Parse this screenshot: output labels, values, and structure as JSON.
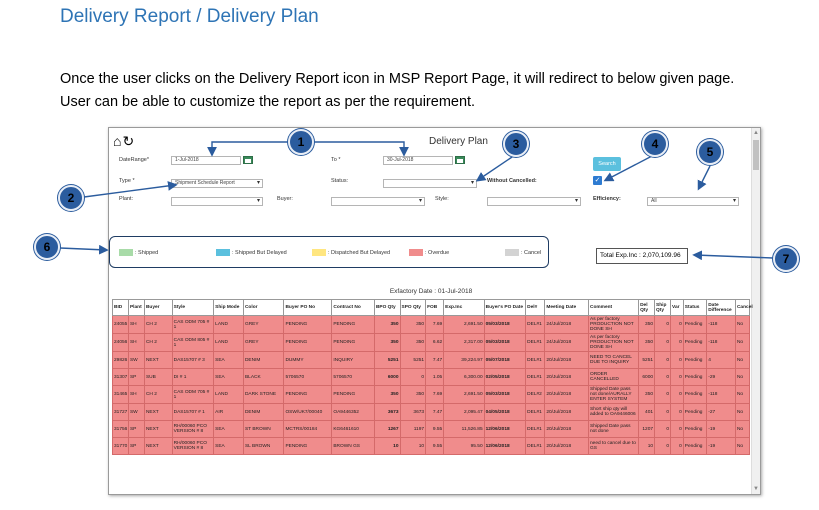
{
  "heading": "Delivery Report / Delivery Plan",
  "paragraph": {
    "line1": "Once the user clicks on the Delivery Report icon in MSP Report Page, it will redirect to below given page.",
    "line2": "User can be able to customize the report as per the requirement."
  },
  "app": {
    "title": "Delivery Plan",
    "filters": {
      "date_range_label": "DateRange*",
      "date_from": "1-Jul-2018",
      "to_label": "To *",
      "date_to": "30-Jul-2018",
      "type_label": "Type *",
      "type_value": "Shipment Schedule Report",
      "status_label": "Status:",
      "status_value": "",
      "without_cancelled_label": "Without Cancelled:",
      "plant_label": "Plant:",
      "buyer_label": "Buyer:",
      "style_label": "Style:",
      "efficiency_label": "Efficiency:",
      "efficiency_value": "All",
      "search_label": "Search"
    },
    "legend": [
      {
        "label": ": Shipped",
        "color": "#a8dba8"
      },
      {
        "label": ": Shipped But Delayed",
        "color": "#5bc0de"
      },
      {
        "label": ": Dispatched But Delayed",
        "color": "#ffe680"
      },
      {
        "label": ": Overdue",
        "color": "#f08c8c"
      },
      {
        "label": ": Cancel",
        "color": "#d3d3d3"
      }
    ],
    "total": "Total Exp.Inc : 2,070,109.96",
    "exfactory_date": "Exfactory Date : 01-Jul-2018",
    "columns": [
      "BID",
      "Plant",
      "Buyer",
      "Style",
      "Ship Mode",
      "Color",
      "Buyer PO No",
      "Contract No",
      "BPO Qty",
      "SPO Qty",
      "FOB",
      "Exp.Inc",
      "Buyer's PO Date",
      "Del#",
      "Meeting Date",
      "Comment",
      "Del Qty",
      "Ship Qty",
      "Var",
      "Status",
      "Date Difference",
      "Cancel"
    ],
    "rows": [
      [
        "24055",
        "SH",
        "CH 2",
        "CAS ODM 705 # 1",
        "LAND",
        "GREY",
        "PENDING",
        "PENDING",
        "350",
        "350",
        "7.69",
        "2,691.50",
        "05/03/2018",
        "DEL#1",
        "24/Jul/2018",
        "As per factory PRODUCTION NOT DONE SH",
        "350",
        "0",
        "0",
        "Pending",
        "-118",
        "No"
      ],
      [
        "24056",
        "SH",
        "CH 2",
        "CAS ODM 805 # 1",
        "LAND",
        "GREY",
        "PENDING",
        "PENDING",
        "350",
        "350",
        "6.62",
        "2,317.00",
        "05/03/2018",
        "DEL#1",
        "24/Jul/2018",
        "As per factory PRODUCTION NOT DONE SH",
        "350",
        "0",
        "0",
        "Pending",
        "-118",
        "No"
      ],
      [
        "29826",
        "SW",
        "NEXT",
        "DAS15707 # 3",
        "SEA",
        "DENIM",
        "DUMMY",
        "INQUIRY",
        "5251",
        "5251",
        "7.47",
        "39,224.97",
        "05/07/2018",
        "DEL#1",
        "20/Jul/2018",
        "NEED TO CANCEL DUE TO INQUIRY",
        "5251",
        "0",
        "0",
        "Pending",
        "4",
        "No"
      ],
      [
        "31307",
        "SP",
        "SUB",
        "DI # 1",
        "SEA",
        "BLACK",
        "5706570",
        "5706570",
        "6000",
        "0",
        "1.05",
        "6,300.00",
        "02/05/2018",
        "DEL#1",
        "20/Jul/2018",
        "ORDER CANCELLED",
        "6000",
        "0",
        "0",
        "Pending",
        "-29",
        "No"
      ],
      [
        "31465",
        "SH",
        "CH 2",
        "CAS ODM 705 # 1",
        "LAND",
        "DARK STONE",
        "PENDING",
        "PENDING",
        "350",
        "350",
        "7.69",
        "2,691.50",
        "05/03/2018",
        "DEL#2",
        "20/Jul/2018",
        "Shipped Date pass not done/AURALLY ENTER SYSTEM",
        "350",
        "0",
        "0",
        "Pending",
        "-118",
        "No"
      ],
      [
        "31727",
        "SW",
        "NEXT",
        "DAS15707 # 1",
        "AIR",
        "DENIM",
        "OSW/UK7/00040",
        "OA9446352",
        "3673",
        "3673",
        "7.47",
        "2,095.47",
        "04/05/2018",
        "DEL#1",
        "20/Jul/2018",
        "Short ship qty will added to OA9446006",
        "401",
        "0",
        "0",
        "Pending",
        "-27",
        "No"
      ],
      [
        "31756",
        "SP",
        "NEXT",
        "RH/00060 PCO VERSION # 8",
        "SEA",
        "ST BROWN",
        "MCTRS/00184",
        "KG6461610",
        "1267",
        "1197",
        "9.55",
        "11,526.85",
        "12/06/2018",
        "DEL#1",
        "20/Jul/2018",
        "Shipped Date pass not done",
        "1207",
        "0",
        "0",
        "Pending",
        "-19",
        "No"
      ],
      [
        "31770",
        "SP",
        "NEXT",
        "RH/00060 PCO VERSION # 8",
        "SEA",
        "SL BROWN",
        "PENDING",
        "BROWN GS",
        "10",
        "10",
        "9.55",
        "95.50",
        "12/06/2018",
        "DEL#1",
        "20/Jul/2018",
        "need to cancel due to GS",
        "10",
        "0",
        "0",
        "Pending",
        "-19",
        "No"
      ]
    ]
  },
  "callouts": [
    "1",
    "2",
    "3",
    "4",
    "5",
    "6",
    "7"
  ]
}
